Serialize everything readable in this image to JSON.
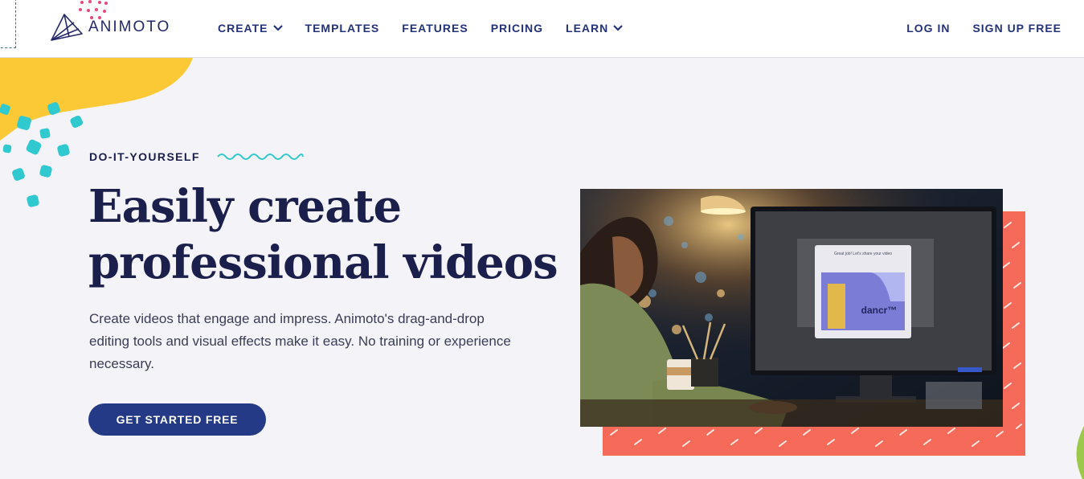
{
  "header": {
    "logo_text": "ANIMOTO",
    "nav": [
      {
        "label": "CREATE",
        "has_dropdown": true
      },
      {
        "label": "TEMPLATES",
        "has_dropdown": false
      },
      {
        "label": "FEATURES",
        "has_dropdown": false
      },
      {
        "label": "PRICING",
        "has_dropdown": false
      },
      {
        "label": "LEARN",
        "has_dropdown": true
      }
    ],
    "login_label": "LOG IN",
    "signup_label": "SIGN UP FREE"
  },
  "hero": {
    "eyebrow": "DO-IT-YOURSELF",
    "headline_line1": "Easily create",
    "headline_line2": "professional videos",
    "subcopy": "Create videos that engage and impress. Animoto's drag-and-drop editing tools and visual effects make it easy. No training or experience necessary.",
    "cta_label": "GET STARTED FREE"
  },
  "image": {
    "modal_title": "Great job! Let's share your video",
    "video_brand": "dancr™"
  },
  "colors": {
    "navy": "#1b1f4b",
    "nav_blue": "#23327a",
    "cta_blue": "#243a86",
    "coral": "#f56a59",
    "yellow": "#fcc936",
    "teal": "#2fc9cf",
    "background": "#f4f3f8"
  },
  "icons": [
    "animoto-logo-icon",
    "chevron-down-icon",
    "wavy-line-icon"
  ]
}
